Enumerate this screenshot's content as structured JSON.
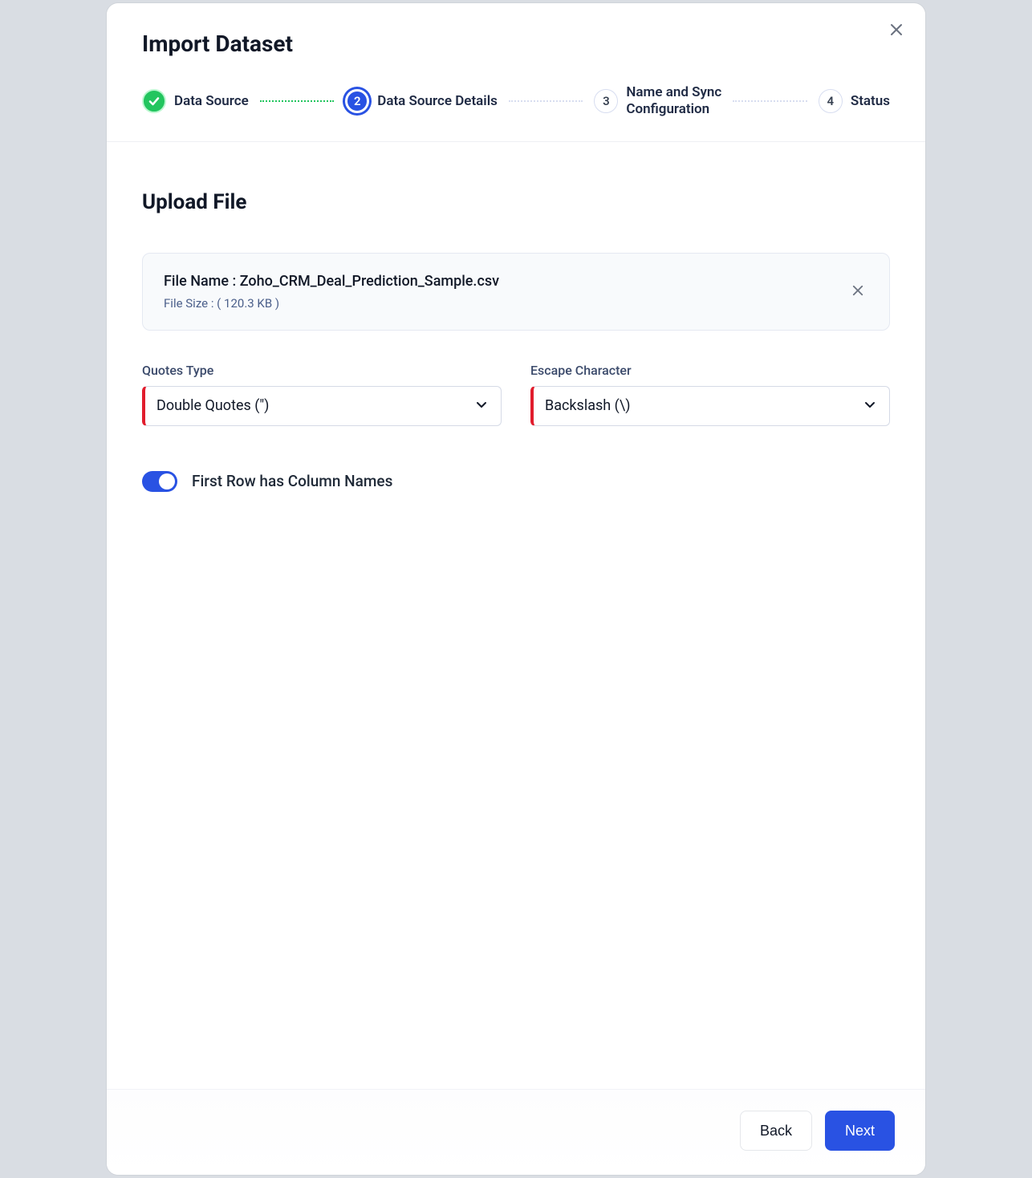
{
  "modal": {
    "title": "Import Dataset"
  },
  "stepper": {
    "steps": [
      {
        "label": "Data Source"
      },
      {
        "number": "2",
        "label": "Data Source Details"
      },
      {
        "number": "3",
        "label": "Name and Sync\nConfiguration"
      },
      {
        "number": "4",
        "label": "Status"
      }
    ]
  },
  "section": {
    "title": "Upload File"
  },
  "file": {
    "name_label": "File Name : ",
    "name_value": "Zoho_CRM_Deal_Prediction_Sample.csv",
    "size_label": "File Size : ",
    "size_value": "( 120.3 KB )"
  },
  "fields": {
    "quotes": {
      "label": "Quotes Type",
      "value": "Double Quotes (\")"
    },
    "escape": {
      "label": "Escape Character",
      "value": "Backslash (\\)"
    }
  },
  "toggle": {
    "first_row_label": "First Row has Column Names",
    "on": true
  },
  "footer": {
    "back": "Back",
    "next": "Next"
  }
}
